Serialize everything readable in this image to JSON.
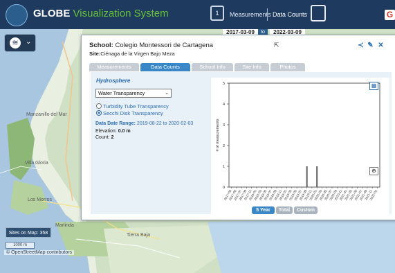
{
  "app": {
    "brand": "GLOBE",
    "subtitle": " Visualization System",
    "measurements_label": "Measurements",
    "data_counts_label": "Data Counts",
    "date_start": "2017-03-09",
    "date_to": "to",
    "date_end": "2022-03-09",
    "google_letter": "G"
  },
  "map": {
    "labels": [
      "Manzanillo del Mar",
      "Villa Gloria",
      "Marlinda",
      "Tierra Baja",
      "Los Morros"
    ],
    "sites_button": "Sites on Map: 358",
    "scale": "1000 m",
    "attribution": "© OpenStreetMap contributors"
  },
  "panel": {
    "school_label": "School:",
    "school_name": "Colegio Montessori de Cartagena",
    "site_label": "Site:",
    "site_name": "Ciénaga de la Virgen Bajo Meza",
    "tabs": [
      "Measurements",
      "Data Counts",
      "School Info",
      "Site Info",
      "Photos"
    ],
    "active_tab": "Data Counts",
    "protocol_group": "Hydrosphere",
    "protocol_select": "Water Transparency",
    "radio_options": [
      "Turbidity Tube Transparency",
      "Secchi Disk Transparency"
    ],
    "radio_selected": "Secchi Disk Transparency",
    "date_range_label": "Data Date Range:",
    "date_range_value": "2019-08-22 to 2020-02-03",
    "elevation_label": "Elevation:",
    "elevation_value": "0.0 m",
    "count_label": "Count:",
    "count_value": "2"
  },
  "chart_buttons": [
    "5 Year",
    "Total",
    "Custom"
  ],
  "colors": {
    "topbar": "#1f3a5f",
    "accent": "#3a87c8",
    "brand_green": "#67c23a",
    "content_bg": "#e8f0f8"
  },
  "chart_data": {
    "type": "bar",
    "ylabel": "# of measurements",
    "ylim": [
      0,
      5
    ],
    "yticks": [
      0,
      1,
      2,
      3,
      4,
      5
    ],
    "categories": [
      "2017-03",
      "2017-05",
      "2017-07",
      "2017-09",
      "2017-11",
      "2018-01",
      "2018-03",
      "2018-05",
      "2018-07",
      "2018-09",
      "2018-11",
      "2019-01",
      "2019-03",
      "2019-05",
      "2019-07",
      "2019-09",
      "2019-11",
      "2020-01",
      "2020-03",
      "2020-05",
      "2020-07",
      "2020-09",
      "2020-11",
      "2021-01",
      "2021-03",
      "2021-05",
      "2021-07",
      "2021-09",
      "2021-11",
      "2022-01"
    ],
    "values": [
      0,
      0,
      0,
      0,
      0,
      0,
      0,
      0,
      0,
      0,
      0,
      0,
      0,
      0,
      0,
      1,
      0,
      1,
      0,
      0,
      0,
      0,
      0,
      0,
      0,
      0,
      0,
      0,
      0,
      0
    ]
  }
}
